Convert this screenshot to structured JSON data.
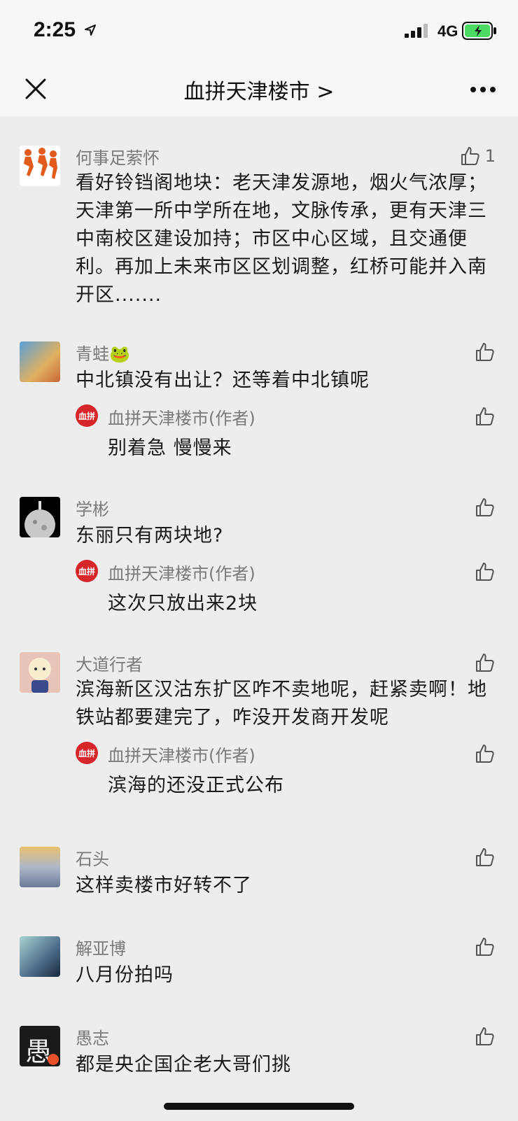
{
  "status": {
    "time": "2:25",
    "network": "4G"
  },
  "nav": {
    "title": "血拼天津楼市 >"
  },
  "author_badge": "血拼",
  "comments": [
    {
      "user": "何事足萦怀",
      "text": "看好铃铛阁地块：老天津发源地，烟火气浓厚；天津第一所中学所在地，文脉传承，更有天津三中南校区建设加持；市区中心区域，且交通便利。再加上未来市区区划调整，红桥可能并入南开区.......",
      "likes": "1"
    },
    {
      "user": "青蛙🐸",
      "text": "中北镇没有出让？还等着中北镇呢",
      "reply": {
        "user": "血拼天津楼市(作者)",
        "text": "别着急 慢慢来"
      }
    },
    {
      "user": "学彬",
      "text": "东丽只有两块地?",
      "reply": {
        "user": "血拼天津楼市(作者)",
        "text": "这次只放出来2块"
      }
    },
    {
      "user": "大道行者",
      "text": "滨海新区汉沽东扩区咋不卖地呢，赶紧卖啊！地铁站都要建完了，咋没开发商开发呢",
      "reply": {
        "user": "血拼天津楼市(作者)",
        "text": "滨海的还没正式公布"
      }
    },
    {
      "user": "石头",
      "text": "这样卖楼市好转不了"
    },
    {
      "user": "解亚博",
      "text": "八月份拍吗"
    },
    {
      "user": "愚志",
      "text": "都是央企国企老大哥们挑",
      "avatar_char": "愚"
    }
  ],
  "colors": {
    "background": "#ededed",
    "header": "#f7f7f7",
    "name": "#7a7a7a",
    "author_red": "#d6252b",
    "battery_green": "#4cd964"
  }
}
